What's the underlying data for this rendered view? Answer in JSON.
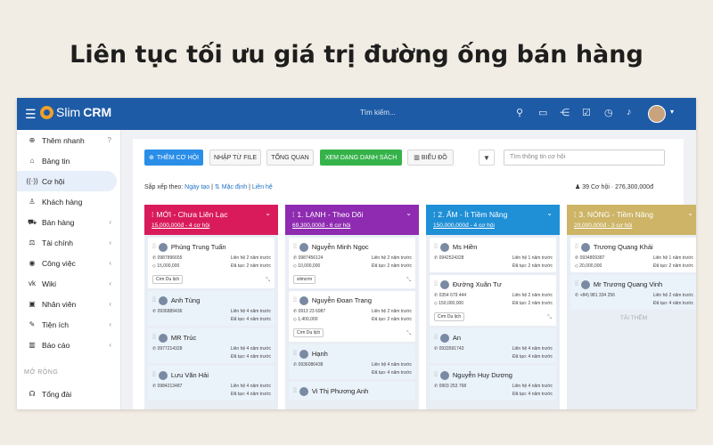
{
  "headline": "Liên tục tối ưu giá trị đường ống bán hàng",
  "app": {
    "logo_prefix": "Slim",
    "logo_bold": "CRM",
    "search_placeholder": "Tìm kiếm...",
    "avatar_dropdown": "▾"
  },
  "sidebar": {
    "quick_add": "Thêm nhanh",
    "items": [
      {
        "label": "Bảng tin",
        "icon": "home-icon",
        "arrow": false
      },
      {
        "label": "Cơ hội",
        "icon": "broadcast-icon",
        "arrow": false,
        "active": true
      },
      {
        "label": "Khách hàng",
        "icon": "user-icon",
        "arrow": false
      },
      {
        "label": "Bán hàng",
        "icon": "cart-icon",
        "arrow": true
      },
      {
        "label": "Tài chính",
        "icon": "scale-icon",
        "arrow": true
      },
      {
        "label": "Công việc",
        "icon": "eye-icon",
        "arrow": true
      },
      {
        "label": "Wiki",
        "icon": "vk-icon",
        "arrow": true
      },
      {
        "label": "Nhân viên",
        "icon": "id-card-icon",
        "arrow": true
      },
      {
        "label": "Tiện ích",
        "icon": "wrench-icon",
        "arrow": true
      },
      {
        "label": "Báo cáo",
        "icon": "bar-chart-icon",
        "arrow": true
      }
    ],
    "section_label": "MỞ RỘNG",
    "extra_item": "Tổng đài"
  },
  "toolbar": {
    "add_opportunity": "THÊM CƠ HỘI",
    "import_file": "NHẬP TỪ FILE",
    "overview": "TỔNG QUAN",
    "list_view": "XEM DẠNG DANH SÁCH",
    "chart": "BIỂU ĐỒ",
    "search_placeholder": "Tìm thông tin cơ hội"
  },
  "sort": {
    "label": "Sắp xếp theo:",
    "option1": "Ngày tạo",
    "separator": " | ",
    "option2": "Mặc định",
    "option3": "Liên hệ"
  },
  "totals": {
    "count": "39 Cơ hội",
    "amount": "276,300,000đ"
  },
  "columns": [
    {
      "title": "MỚI - Chưa Liên Lạc",
      "summary": "15,000,000đ - 4 cơ hội",
      "color": "#d91b5c",
      "cards": [
        {
          "name": "Phùng Trung Tuấn",
          "phone": "0987896655",
          "amount": "15,000,000",
          "contact": "Liên hệ 2 năm trước",
          "created": "Đã tạo: 2 năm trước",
          "tag": "Crm Du lịch",
          "tint": false
        },
        {
          "name": "Anh Tùng",
          "phone": "0936889436",
          "contact": "Liên hệ 4 năm trước",
          "created": "Đã tạo: 4 năm trước",
          "tint": true
        },
        {
          "name": "MR Trúc",
          "phone": "0977214328",
          "contact": "Liên hệ 4 năm trước",
          "created": "Đã tạo: 4 năm trước",
          "tint": true
        },
        {
          "name": "Lưu Văn Hải",
          "phone": "0984213487",
          "contact": "Liên hệ 4 năm trước",
          "created": "Đã tạo: 4 năm trước",
          "tint": true
        }
      ]
    },
    {
      "title": "1. LẠNH - Theo Dõi",
      "summary": "69,300,000đ - 6 cơ hội",
      "color": "#8e2bb0",
      "cards": [
        {
          "name": "Nguyễn Minh Ngọc",
          "phone": "0987456124",
          "amount": "10,000,000",
          "contact": "Liên hệ 2 năm trước",
          "created": "Đã tạo: 2 năm trước",
          "tag": "slimcrm",
          "tint": false
        },
        {
          "name": "Nguyễn Đoan Trang",
          "phone": "0913 23 6987",
          "amount": "1,400,000",
          "contact": "Liên hệ 2 năm trước",
          "created": "Đã tạo: 2 năm trước",
          "tag": "Crm Du lịch",
          "tint": false
        },
        {
          "name": "Hạnh",
          "phone": "0936086438",
          "contact": "Liên hệ 4 năm trước",
          "created": "Đã tạo: 4 năm trước",
          "tint": true
        },
        {
          "name": "Vi Thị Phương Anh",
          "phone": "",
          "contact": "",
          "created": "",
          "tint": true
        }
      ]
    },
    {
      "title": "2. ẤM - Ít Tiềm Năng",
      "summary": "150,000,000đ - 4 cơ hội",
      "color": "#1f8fd6",
      "cards": [
        {
          "name": "Ms Hiền",
          "phone": "0942524328",
          "contact": "Liên hệ 1 năm trước",
          "created": "Đã tạo: 2 năm trước",
          "tint": false
        },
        {
          "name": "Đường Xuân Tư",
          "phone": "0354 679 444",
          "amount": "150,000,000",
          "contact": "Liên hệ 2 năm trước",
          "created": "Đã tạo: 2 năm trước",
          "tag": "Crm Du lịch",
          "tint": false
        },
        {
          "name": "An",
          "phone": "0933591743",
          "contact": "Liên hệ 4 năm trước",
          "created": "Đã tạo: 4 năm trước",
          "tint": true
        },
        {
          "name": "Nguyễn Huy Dương",
          "phone": "0903 253 768",
          "contact": "Liên hệ 4 năm trước",
          "created": "Đã tạo: 4 năm trước",
          "tint": true
        }
      ]
    },
    {
      "title": "3. NÓNG - Tiềm Năng",
      "summary": "20,000,000đ - 3 cơ hội",
      "color": "#cdb466",
      "cards": [
        {
          "name": "Trương Quang Khải",
          "phone": "0934809387",
          "amount": "20,000,000",
          "contact": "Liên hệ 1 năm trước",
          "created": "Đã tạo: 2 năm trước",
          "tint": false
        },
        {
          "name": "Mr Trương Quang Vinh",
          "phone": "+84) 981 334 256",
          "contact": "Liên hệ 2 năm trước",
          "created": "Đã tạo: 4 năm trước",
          "tint": true
        }
      ],
      "add_more": "TẢI THÊM"
    }
  ]
}
